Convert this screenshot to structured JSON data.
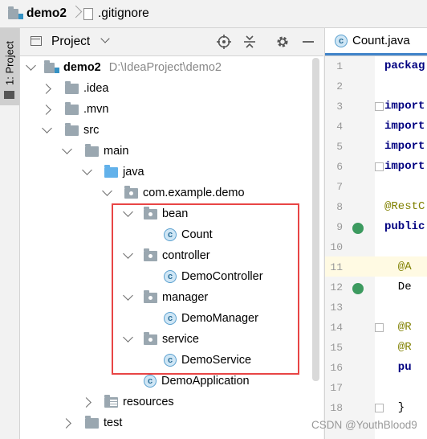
{
  "breadcrumb": {
    "project": "demo2",
    "file": ".gitignore"
  },
  "sidebar_strip": {
    "tab_label": "1: Project"
  },
  "project_panel": {
    "title": "Project",
    "toolbar_icons": [
      "locate-icon",
      "collapse-icon",
      "gear-icon",
      "minimize-icon"
    ],
    "tree": {
      "root": {
        "name": "demo2",
        "path": "D:\\IdeaProject\\demo2"
      },
      "idea": ".idea",
      "mvn": ".mvn",
      "src": "src",
      "main": "main",
      "java": "java",
      "package": "com.example.demo",
      "bean": "bean",
      "count": "Count",
      "controller": "controller",
      "demo_controller": "DemoController",
      "manager": "manager",
      "demo_manager": "DemoManager",
      "service": "service",
      "demo_service": "DemoService",
      "demo_application": "DemoApplication",
      "resources": "resources",
      "test": "test"
    }
  },
  "editor": {
    "tab": "Count.java",
    "lines": [
      {
        "n": "1",
        "code": "packag"
      },
      {
        "n": "2",
        "code": ""
      },
      {
        "n": "3",
        "code": "import"
      },
      {
        "n": "4",
        "code": "import"
      },
      {
        "n": "5",
        "code": "import"
      },
      {
        "n": "6",
        "code": "import"
      },
      {
        "n": "7",
        "code": ""
      },
      {
        "n": "8",
        "code": "@RestC"
      },
      {
        "n": "9",
        "code": "public"
      },
      {
        "n": "10",
        "code": ""
      },
      {
        "n": "11",
        "code": "  @A"
      },
      {
        "n": "12",
        "code": "  De"
      },
      {
        "n": "13",
        "code": ""
      },
      {
        "n": "14",
        "code": "  @R"
      },
      {
        "n": "15",
        "code": "  @R"
      },
      {
        "n": "16",
        "code": "  pu"
      },
      {
        "n": "17",
        "code": ""
      },
      {
        "n": "18",
        "code": "  }"
      }
    ]
  },
  "watermark": "CSDN @YouthBlood9"
}
